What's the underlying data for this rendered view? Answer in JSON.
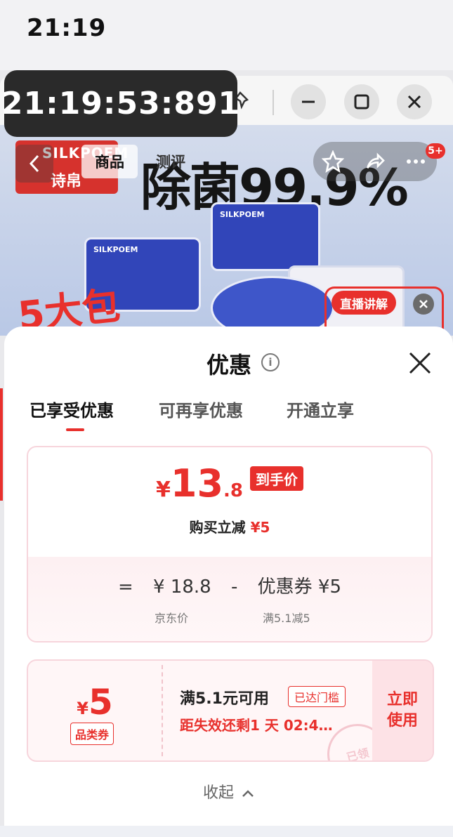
{
  "status": {
    "time": "21:19"
  },
  "timer": {
    "text": "21:19:53:891"
  },
  "product": {
    "tabs": [
      "商品",
      "测评"
    ],
    "brand_en": "SILKPOEM",
    "brand_cn": "诗帛",
    "headline": "除菌99.9%",
    "pack_text": "5大包",
    "cart_count": "5+",
    "live_label": "直播讲解"
  },
  "sheet": {
    "title": "优惠",
    "tabs": [
      "已享受优惠",
      "可再享优惠",
      "开通立享"
    ],
    "price": {
      "currency": "¥",
      "integer": "13",
      "decimal": ".8",
      "tag": "到手价",
      "buy_text": "购买立减",
      "buy_discount": "¥5"
    },
    "calc": {
      "equals": "=",
      "base": "¥ 18.8",
      "minus": "-",
      "coupon": "优惠券 ¥5",
      "base_label": "京东价",
      "coupon_label": "满5.1减5"
    },
    "coupon": {
      "currency": "¥",
      "amount": "5",
      "type": "品类券",
      "condition": "满5.1元可用",
      "badge": "已达门槛",
      "expire": "距失效还剩1 天 02:4…",
      "use": "立即使用",
      "stamp": "已领"
    },
    "collapse": "收起"
  },
  "colors": {
    "accent": "#e8302c",
    "card_border": "#f7d5dc"
  }
}
